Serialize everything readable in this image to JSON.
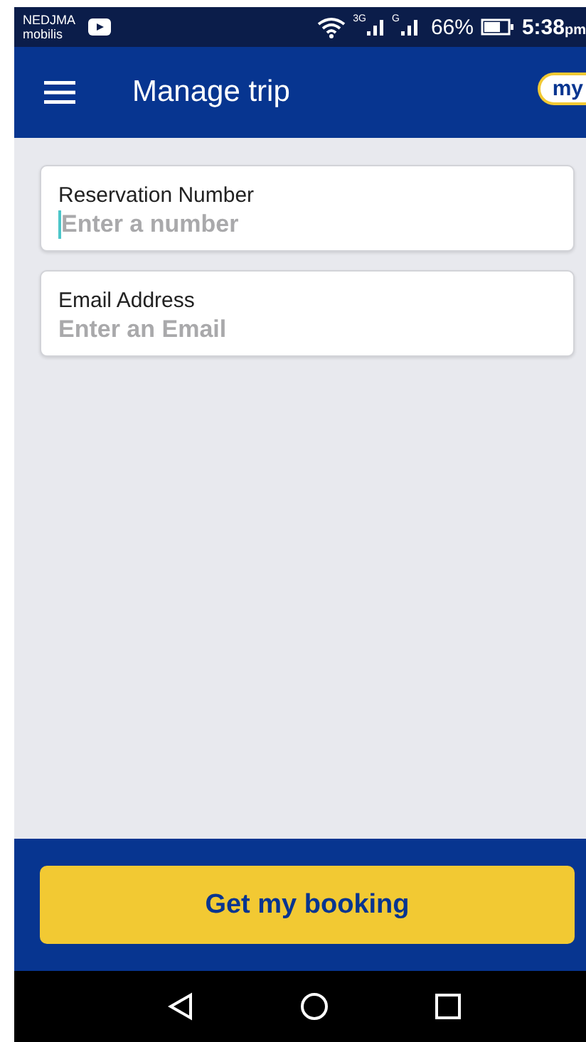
{
  "status_bar": {
    "carrier": "NEDJMA",
    "carrier_sub": "mobilis",
    "network_1": "3G",
    "network_2": "G",
    "battery": "66%",
    "time": "5:38",
    "time_suffix": "pm"
  },
  "app_bar": {
    "title": "Manage trip",
    "logo": "my"
  },
  "fields": [
    {
      "label": "Reservation Number",
      "placeholder": "Enter a number",
      "focused": true
    },
    {
      "label": "Email Address",
      "placeholder": "Enter an Email",
      "focused": false
    }
  ],
  "button": "Get my booking"
}
